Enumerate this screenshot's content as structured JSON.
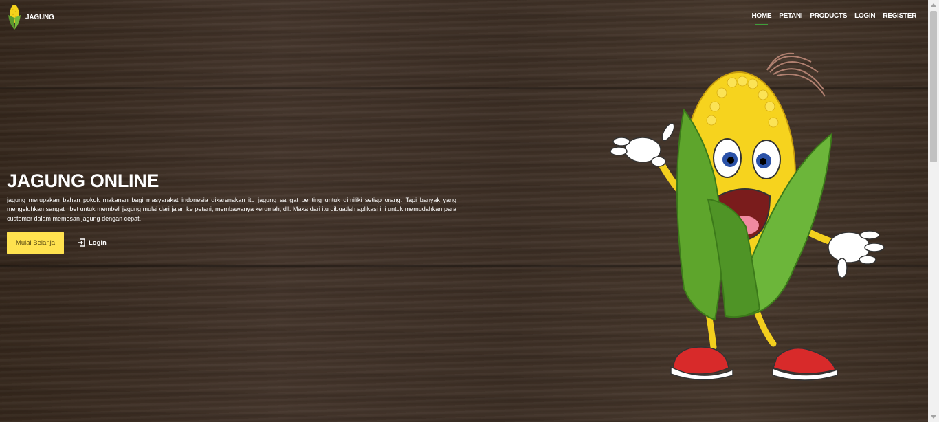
{
  "brand": {
    "name": "JAGUNG",
    "logo_icon": "corn-icon"
  },
  "nav": {
    "items": [
      {
        "label": "HOME",
        "active": true
      },
      {
        "label": "PETANI"
      },
      {
        "label": "PRODUCTS"
      },
      {
        "label": "LOGIN"
      },
      {
        "label": "REGISTER"
      }
    ]
  },
  "hero": {
    "title": "JAGUNG ONLINE",
    "description": "jagung merupakan bahan pokok makanan bagi masyarakat indonesia dikarenakan itu jagung sangat penting untuk dimiliki setiap orang. Tapi banyak yang mengeluhkan sangat ribet untuk membeli jagung mulai dari jalan ke petani, membawanya kerumah, dll. Maka dari itu dibuatlah aplikasi ini untuk memudahkan para customer dalam memesan jagung dengan cepat.",
    "primary_button": "Mulai Belanja",
    "login_link": "Login",
    "login_icon": "login-icon"
  },
  "colors": {
    "accent_yellow": "#ffe24f",
    "nav_active_underline": "#3f9e3a",
    "background_wood": "#3a2c20"
  }
}
